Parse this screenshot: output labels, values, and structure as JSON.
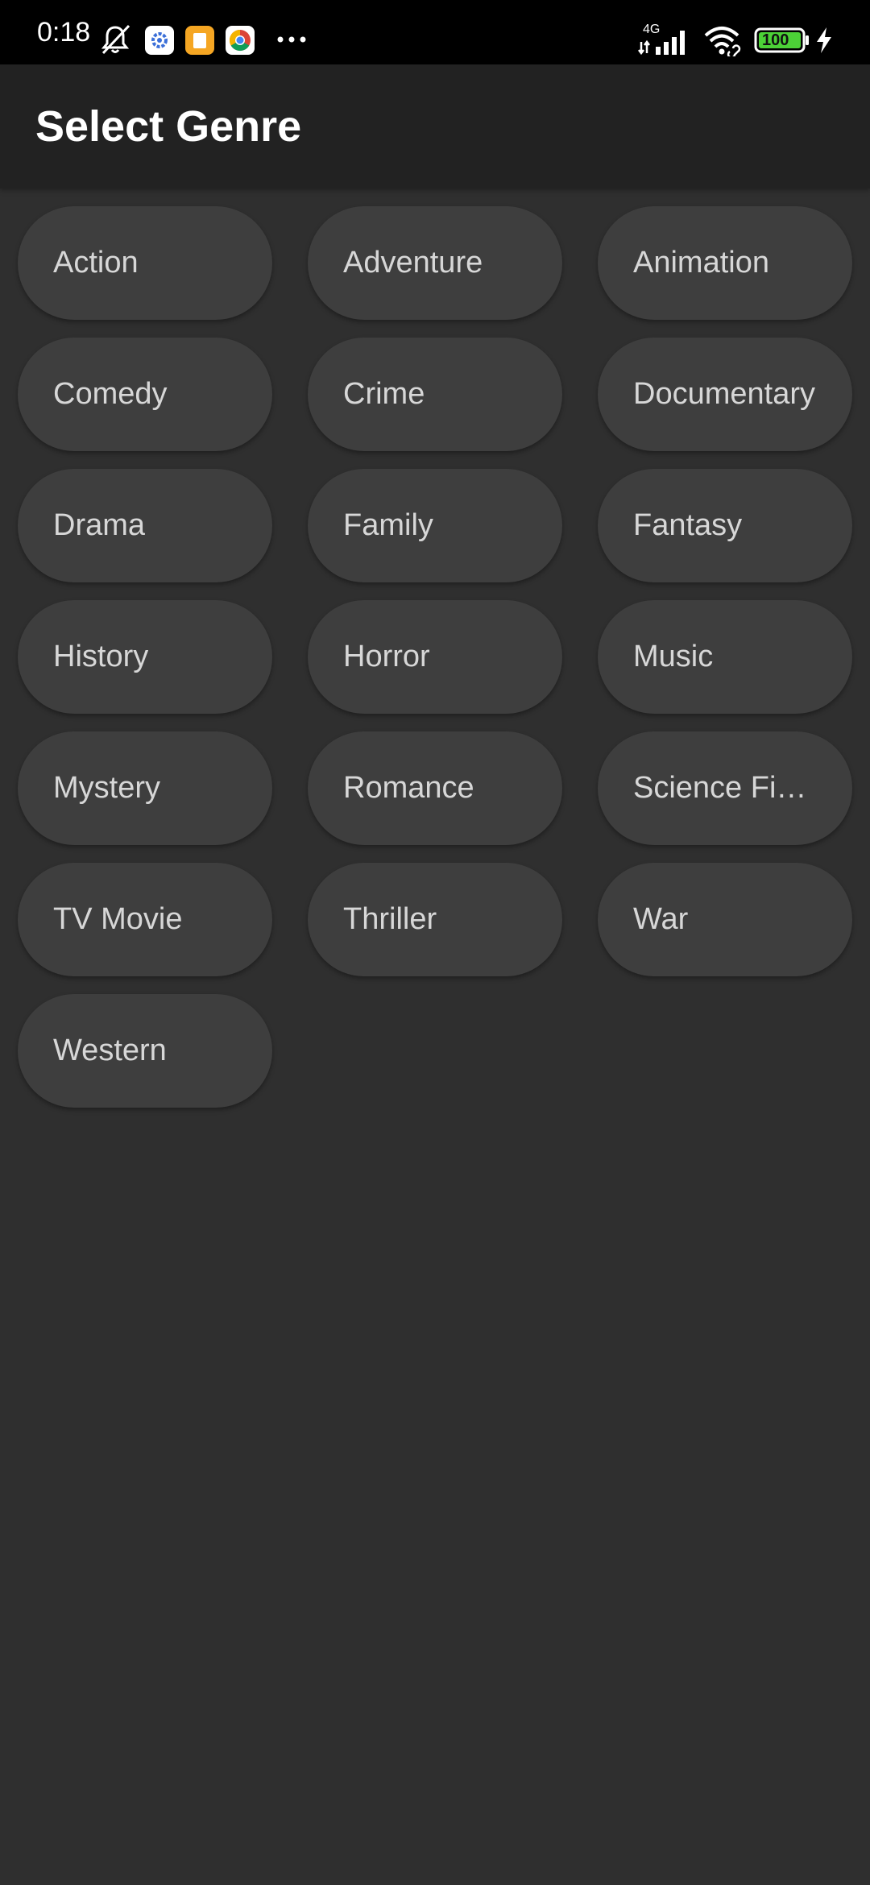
{
  "status_bar": {
    "time": "0:18",
    "network_label": "4G",
    "battery_level": "100",
    "icons": [
      "mute-icon",
      "settings-app-icon",
      "notes-app-icon",
      "chrome-icon",
      "more-dots-icon",
      "signal-icon",
      "wifi-icon",
      "battery-icon",
      "charging-icon"
    ]
  },
  "app_bar": {
    "title": "Select Genre"
  },
  "genres": [
    "Action",
    "Adventure",
    "Animation",
    "Comedy",
    "Crime",
    "Documentary",
    "Drama",
    "Family",
    "Fantasy",
    "History",
    "Horror",
    "Music",
    "Mystery",
    "Romance",
    "Science Fiction",
    "TV Movie",
    "Thriller",
    "War",
    "Western"
  ],
  "colors": {
    "background": "#2f2f2f",
    "app_bar": "#222222",
    "chip": "#3e3e3e",
    "chip_text": "#d7d7d7",
    "battery_green": "#4cd137"
  }
}
